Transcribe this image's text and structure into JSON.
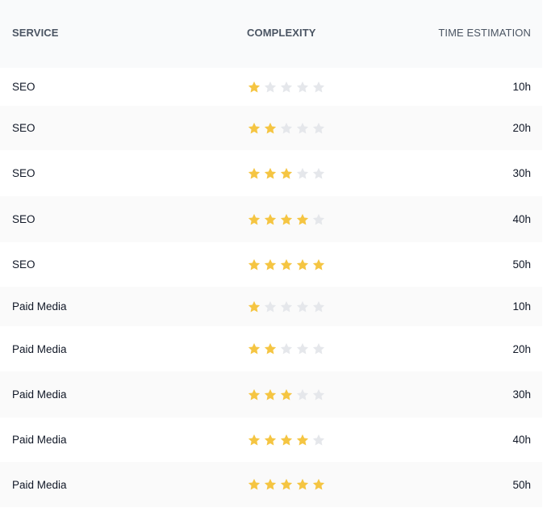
{
  "table": {
    "headers": {
      "service": "SERVICE",
      "complexity": "COMPLEXITY",
      "time": "TIME ESTIMATION"
    },
    "max_stars": 5,
    "colors": {
      "star_filled": "#f5c542",
      "star_empty": "#e5e7eb"
    },
    "rows": [
      {
        "service": "SEO",
        "complexity": 1,
        "time": "10h"
      },
      {
        "service": "SEO",
        "complexity": 2,
        "time": "20h"
      },
      {
        "service": "SEO",
        "complexity": 3,
        "time": "30h"
      },
      {
        "service": "SEO",
        "complexity": 4,
        "time": "40h"
      },
      {
        "service": "SEO",
        "complexity": 5,
        "time": "50h"
      },
      {
        "service": "Paid Media",
        "complexity": 1,
        "time": "10h"
      },
      {
        "service": "Paid Media",
        "complexity": 2,
        "time": "20h"
      },
      {
        "service": "Paid Media",
        "complexity": 3,
        "time": "30h"
      },
      {
        "service": "Paid Media",
        "complexity": 4,
        "time": "40h"
      },
      {
        "service": "Paid Media",
        "complexity": 5,
        "time": "50h"
      }
    ]
  }
}
